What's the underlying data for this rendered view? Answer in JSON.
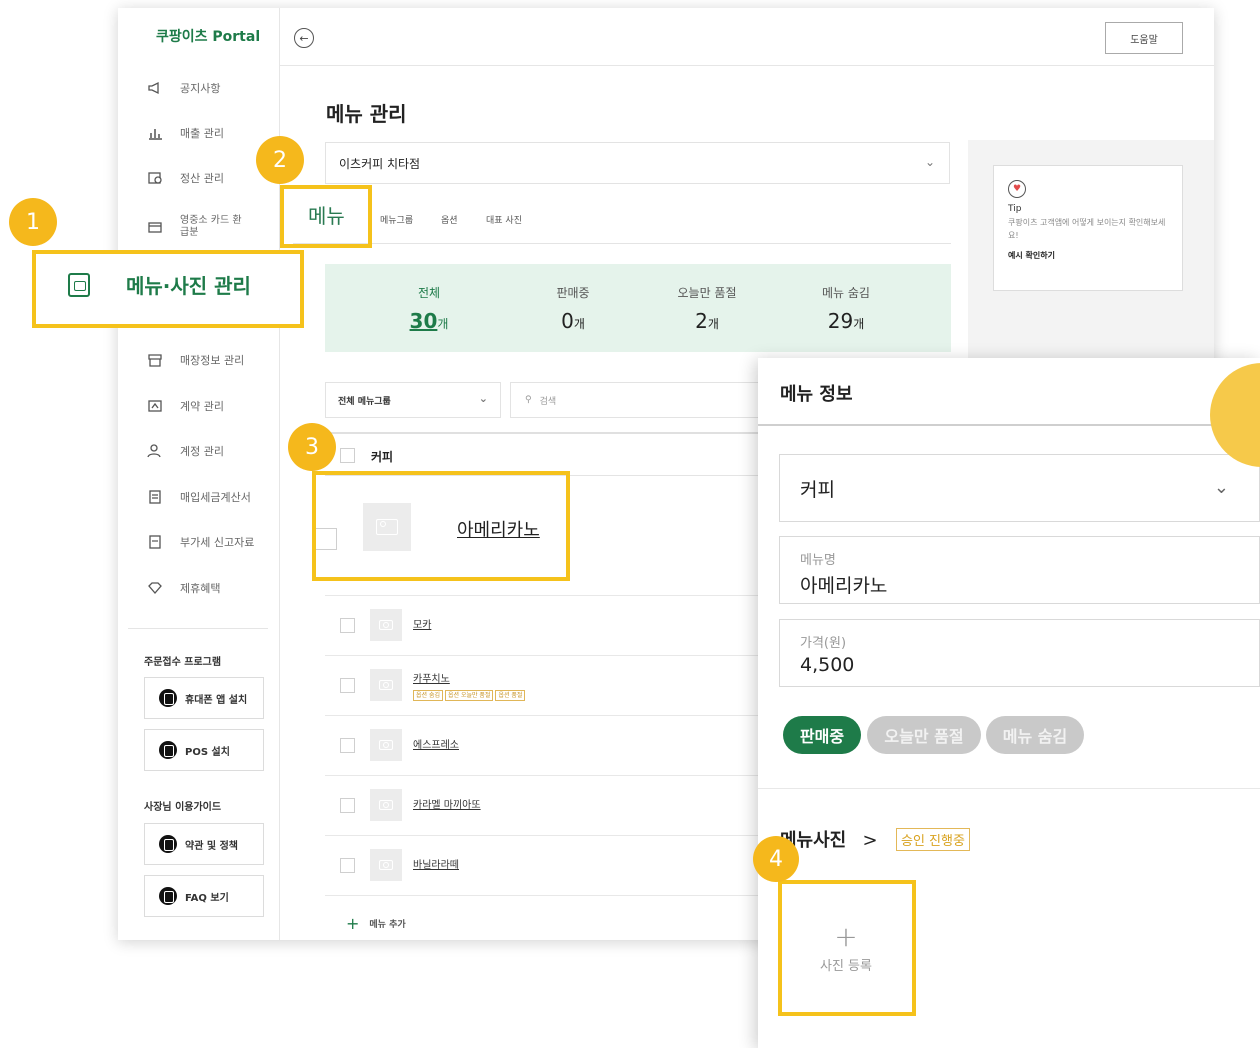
{
  "portal": {
    "logo": "쿠팡이츠 Portal",
    "help_label": "도움말",
    "back_icon": "arrow-left-icon"
  },
  "sidebar": {
    "items": [
      {
        "label": "공지사항",
        "icon": "megaphone-icon"
      },
      {
        "label": "매출 관리",
        "icon": "chart-icon"
      },
      {
        "label": "정산 관리",
        "icon": "settlement-icon"
      },
      {
        "label": "영중소 카드 환급분",
        "icon": "card-icon"
      },
      {
        "label": "매장정보 관리",
        "icon": "store-icon"
      },
      {
        "label": "계약 관리",
        "icon": "contract-icon"
      },
      {
        "label": "계정 관리",
        "icon": "user-icon"
      },
      {
        "label": "매입세금계산서",
        "icon": "invoice-icon"
      },
      {
        "label": "부가세 신고자료",
        "icon": "document-icon"
      },
      {
        "label": "제휴혜택",
        "icon": "diamond-icon"
      }
    ],
    "highlight_label": "메뉴·사진 관리",
    "order_program_title": "주문접수 프로그램",
    "order_buttons": [
      "휴대폰 앱 설치",
      "POS 설치"
    ],
    "guide_title": "사장님 이용가이드",
    "guide_buttons": [
      "약관 및 정책",
      "FAQ 보기"
    ]
  },
  "main": {
    "title": "메뉴 관리",
    "store_select": "이츠커피 치타점",
    "tabs": [
      "메뉴",
      "메뉴그룹",
      "옵션",
      "대표 사진"
    ],
    "stats": [
      {
        "label": "전체",
        "value": "30",
        "unit": "개"
      },
      {
        "label": "판매중",
        "value": "0",
        "unit": "개"
      },
      {
        "label": "오늘만 품절",
        "value": "2",
        "unit": "개"
      },
      {
        "label": "메뉴 숨김",
        "value": "29",
        "unit": "개"
      }
    ],
    "group_select": "전체 메뉴그룹",
    "search_placeholder": "검색",
    "category": "커피",
    "menus": [
      {
        "name": "아메리카노"
      },
      {
        "name": "모카"
      },
      {
        "name": "카푸치노",
        "badges": [
          "옵션 숨김",
          "옵션 오늘만 품절",
          "옵션 품절"
        ]
      },
      {
        "name": "에스프레소"
      },
      {
        "name": "카라멜 마끼아또"
      },
      {
        "name": "바닐라라떼"
      }
    ],
    "add_menu": "메뉴 추가"
  },
  "tip": {
    "title": "Tip",
    "text": "쿠팡이츠 고객앱에 어떻게 보이는지 확인해보세요!",
    "link": "예시 확인하기"
  },
  "detail": {
    "title": "메뉴 정보",
    "group_value": "커피",
    "name_label": "메뉴명",
    "name_value": "아메리카노",
    "price_label": "가격(원)",
    "price_value": "4,500",
    "status_buttons": [
      "판매중",
      "오늘만 품절",
      "메뉴 숨김"
    ],
    "photo_title": "메뉴사진",
    "photo_arrow": ">",
    "approval_status": "승인 진행중",
    "photo_add_label": "사진 등록"
  },
  "steps": [
    "1",
    "2",
    "3",
    "4"
  ],
  "colors": {
    "brand_green": "#1e7b49",
    "highlight_yellow": "#f5c21b",
    "stats_bg": "#e5f3eb"
  }
}
